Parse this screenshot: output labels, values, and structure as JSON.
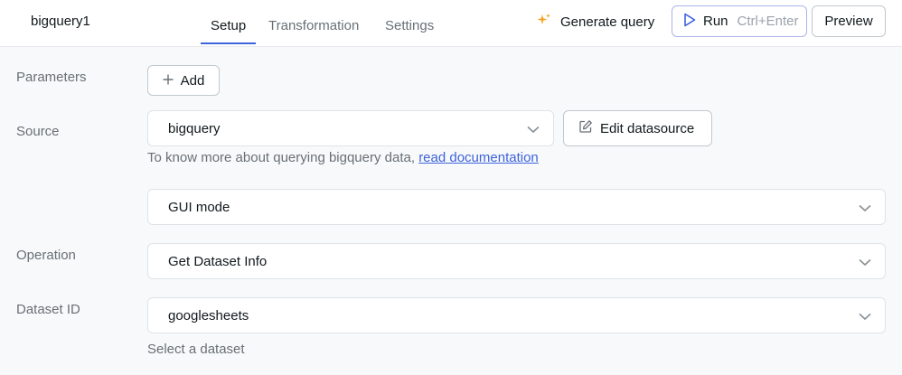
{
  "header": {
    "query_name": "bigquery1",
    "tabs": [
      {
        "label": "Setup",
        "active": true
      },
      {
        "label": "Transformation",
        "active": false
      },
      {
        "label": "Settings",
        "active": false
      }
    ],
    "generate_label": "Generate query",
    "run_label": "Run",
    "run_shortcut": "Ctrl+Enter",
    "preview_label": "Preview",
    "accent_color": "#3e63dd",
    "sparkle_color": "#f5a524"
  },
  "form": {
    "parameters_label": "Parameters",
    "add_label": "Add",
    "source_label": "Source",
    "source_value": "bigquery",
    "edit_datasource_label": "Edit datasource",
    "help_text": "To know more about querying bigquery data,",
    "help_link": "read documentation",
    "mode_value": "GUI mode",
    "operation_label": "Operation",
    "operation_value": "Get Dataset Info",
    "dataset_label": "Dataset ID",
    "dataset_value": "googlesheets",
    "dataset_hint": "Select a dataset"
  }
}
